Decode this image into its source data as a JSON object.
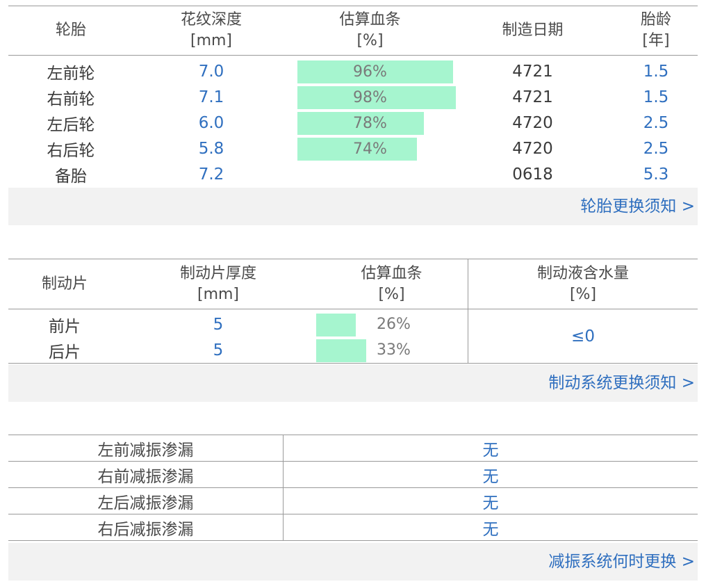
{
  "tyres": {
    "headers": {
      "name": "轮胎",
      "depth_line1": "花纹深度",
      "depth_line2": "[mm]",
      "health_line1": "估算血条",
      "health_line2": "[%]",
      "date": "制造日期",
      "age_line1": "胎龄",
      "age_line2": "[年]"
    },
    "rows": [
      {
        "name": "左前轮",
        "depth": "7.0",
        "health": "96%",
        "health_value": 96,
        "date": "4721",
        "age": "1.5"
      },
      {
        "name": "右前轮",
        "depth": "7.1",
        "health": "98%",
        "health_value": 98,
        "date": "4721",
        "age": "1.5"
      },
      {
        "name": "左后轮",
        "depth": "6.0",
        "health": "78%",
        "health_value": 78,
        "date": "4720",
        "age": "2.5"
      },
      {
        "name": "右后轮",
        "depth": "5.8",
        "health": "74%",
        "health_value": 74,
        "date": "4720",
        "age": "2.5"
      },
      {
        "name": "备胎",
        "depth": "7.2",
        "health": "",
        "health_value": null,
        "date": "0618",
        "age": "5.3"
      }
    ],
    "link": "轮胎更换须知 >"
  },
  "brakes": {
    "headers": {
      "name": "制动片",
      "thickness_line1": "制动片厚度",
      "thickness_line2": "[mm]",
      "health_line1": "估算血条",
      "health_line2": "[%]",
      "fluid_line1": "制动液含水量",
      "fluid_line2": "[%]"
    },
    "rows": [
      {
        "name": "前片",
        "thickness": "5",
        "health": "26%",
        "health_value": 26
      },
      {
        "name": "后片",
        "thickness": "5",
        "health": "33%",
        "health_value": 33
      }
    ],
    "fluid_moisture": "≤0",
    "link": "制动系统更换须知 >"
  },
  "shocks": {
    "rows": [
      {
        "label": "左前减振渗漏",
        "value": "无"
      },
      {
        "label": "右前减振渗漏",
        "value": "无"
      },
      {
        "label": "左后减振渗漏",
        "value": "无"
      },
      {
        "label": "右后减振渗漏",
        "value": "无"
      }
    ],
    "link": "减振系统何时更换 >"
  },
  "colors": {
    "accent": "#2f6fbf",
    "bar": "#a6f5cf",
    "footer_bg": "#f2f2f2",
    "divider": "#9a9a9a"
  }
}
